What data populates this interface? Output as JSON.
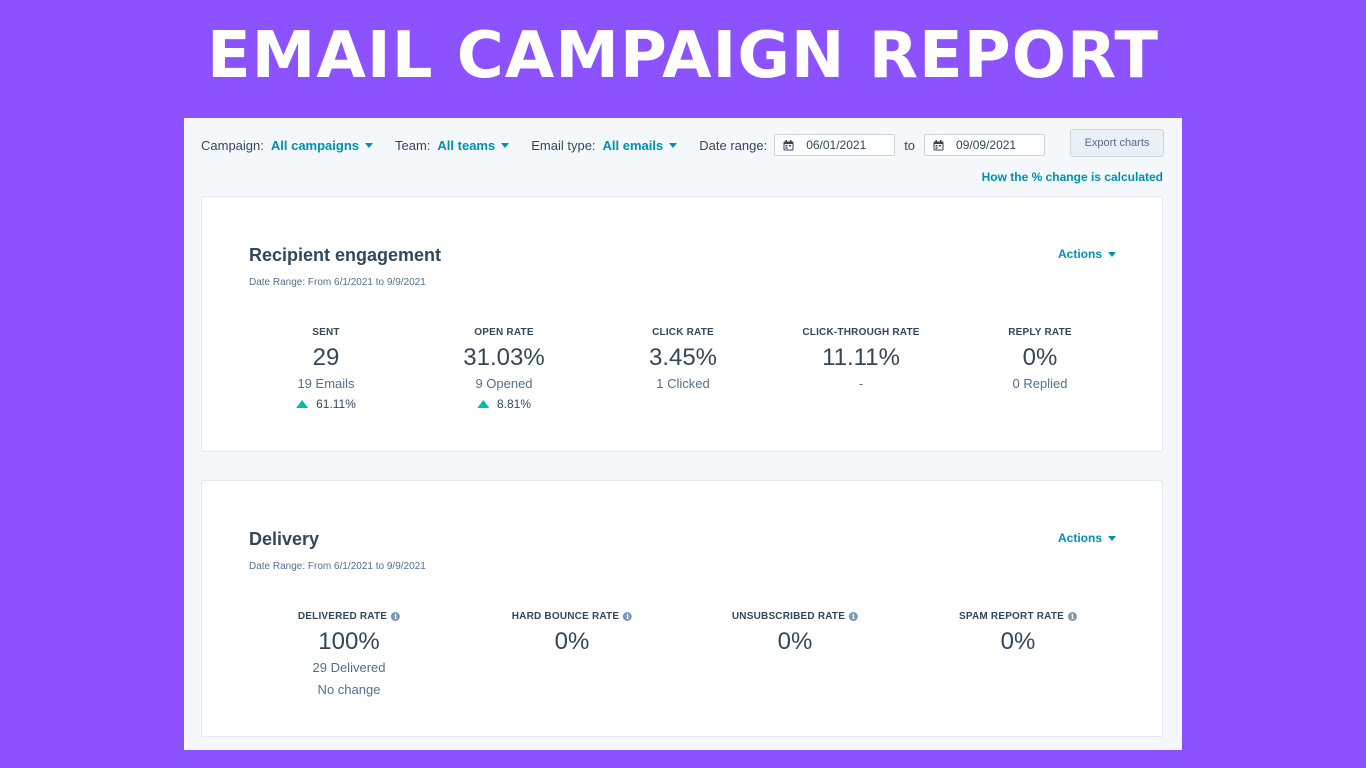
{
  "banner": {
    "title": "EMAIL CAMPAIGN REPORT"
  },
  "filters": {
    "campaign": {
      "label": "Campaign:",
      "value": "All campaigns"
    },
    "team": {
      "label": "Team:",
      "value": "All teams"
    },
    "email_type": {
      "label": "Email type:",
      "value": "All emails"
    },
    "date_range": {
      "label": "Date range:",
      "start": "06/01/2021",
      "to": "to",
      "end": "09/09/2021"
    }
  },
  "toolbar": {
    "export_label": "Export charts",
    "pct_link": "How the % change is calculated"
  },
  "engagement": {
    "title": "Recipient engagement",
    "subtitle": "Date Range: From 6/1/2021 to 9/9/2021",
    "actions_label": "Actions",
    "metrics": [
      {
        "label": "SENT",
        "value": "29",
        "sub": "19 Emails",
        "change": "61.11%"
      },
      {
        "label": "OPEN RATE",
        "value": "31.03%",
        "sub": "9 Opened",
        "change": "8.81%"
      },
      {
        "label": "CLICK RATE",
        "value": "3.45%",
        "sub": "1 Clicked"
      },
      {
        "label": "CLICK-THROUGH RATE",
        "value": "11.11%",
        "sub": "-"
      },
      {
        "label": "REPLY RATE",
        "value": "0%",
        "sub": "0 Replied"
      }
    ]
  },
  "delivery": {
    "title": "Delivery",
    "subtitle": "Date Range: From 6/1/2021 to 9/9/2021",
    "actions_label": "Actions",
    "metrics": [
      {
        "label": "DELIVERED RATE",
        "value": "100%",
        "sub": "29 Delivered",
        "change": "No change"
      },
      {
        "label": "HARD BOUNCE RATE",
        "value": "0%"
      },
      {
        "label": "UNSUBSCRIBED RATE",
        "value": "0%"
      },
      {
        "label": "SPAM REPORT RATE",
        "value": "0%"
      }
    ]
  },
  "colors": {
    "background": "#8c52ff",
    "accent": "#0091ae",
    "positive": "#00bda5"
  },
  "icons": {
    "calendar": "calendar-icon",
    "info": "info-icon",
    "up": "trend-up-icon"
  }
}
